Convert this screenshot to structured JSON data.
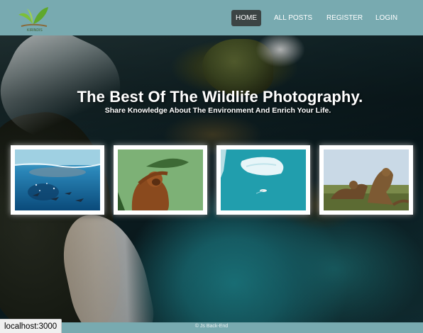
{
  "nav": {
    "logo_text": "KIRINDIS",
    "links": [
      {
        "label": "HOME",
        "active": true
      },
      {
        "label": "ALL POSTS",
        "active": false
      },
      {
        "label": "REGISTER",
        "active": false
      },
      {
        "label": "LOGIN",
        "active": false
      }
    ]
  },
  "hero": {
    "title": "The Best Of The Wildlife Photography.",
    "subtitle": "Share Knowledge About The Environment And Enrich Your Life."
  },
  "gallery": [
    {
      "subject": "underwater-sea-life"
    },
    {
      "subject": "orangutan-with-leaf"
    },
    {
      "subject": "iceberg-and-boat"
    },
    {
      "subject": "iguanas"
    }
  ],
  "footer": {
    "text": "© Js Back-End"
  },
  "status_bar": {
    "url": "localhost:3000"
  },
  "colors": {
    "navbar": "#78aab0",
    "active_link_bg": "#3c4444",
    "text": "#ffffff"
  }
}
